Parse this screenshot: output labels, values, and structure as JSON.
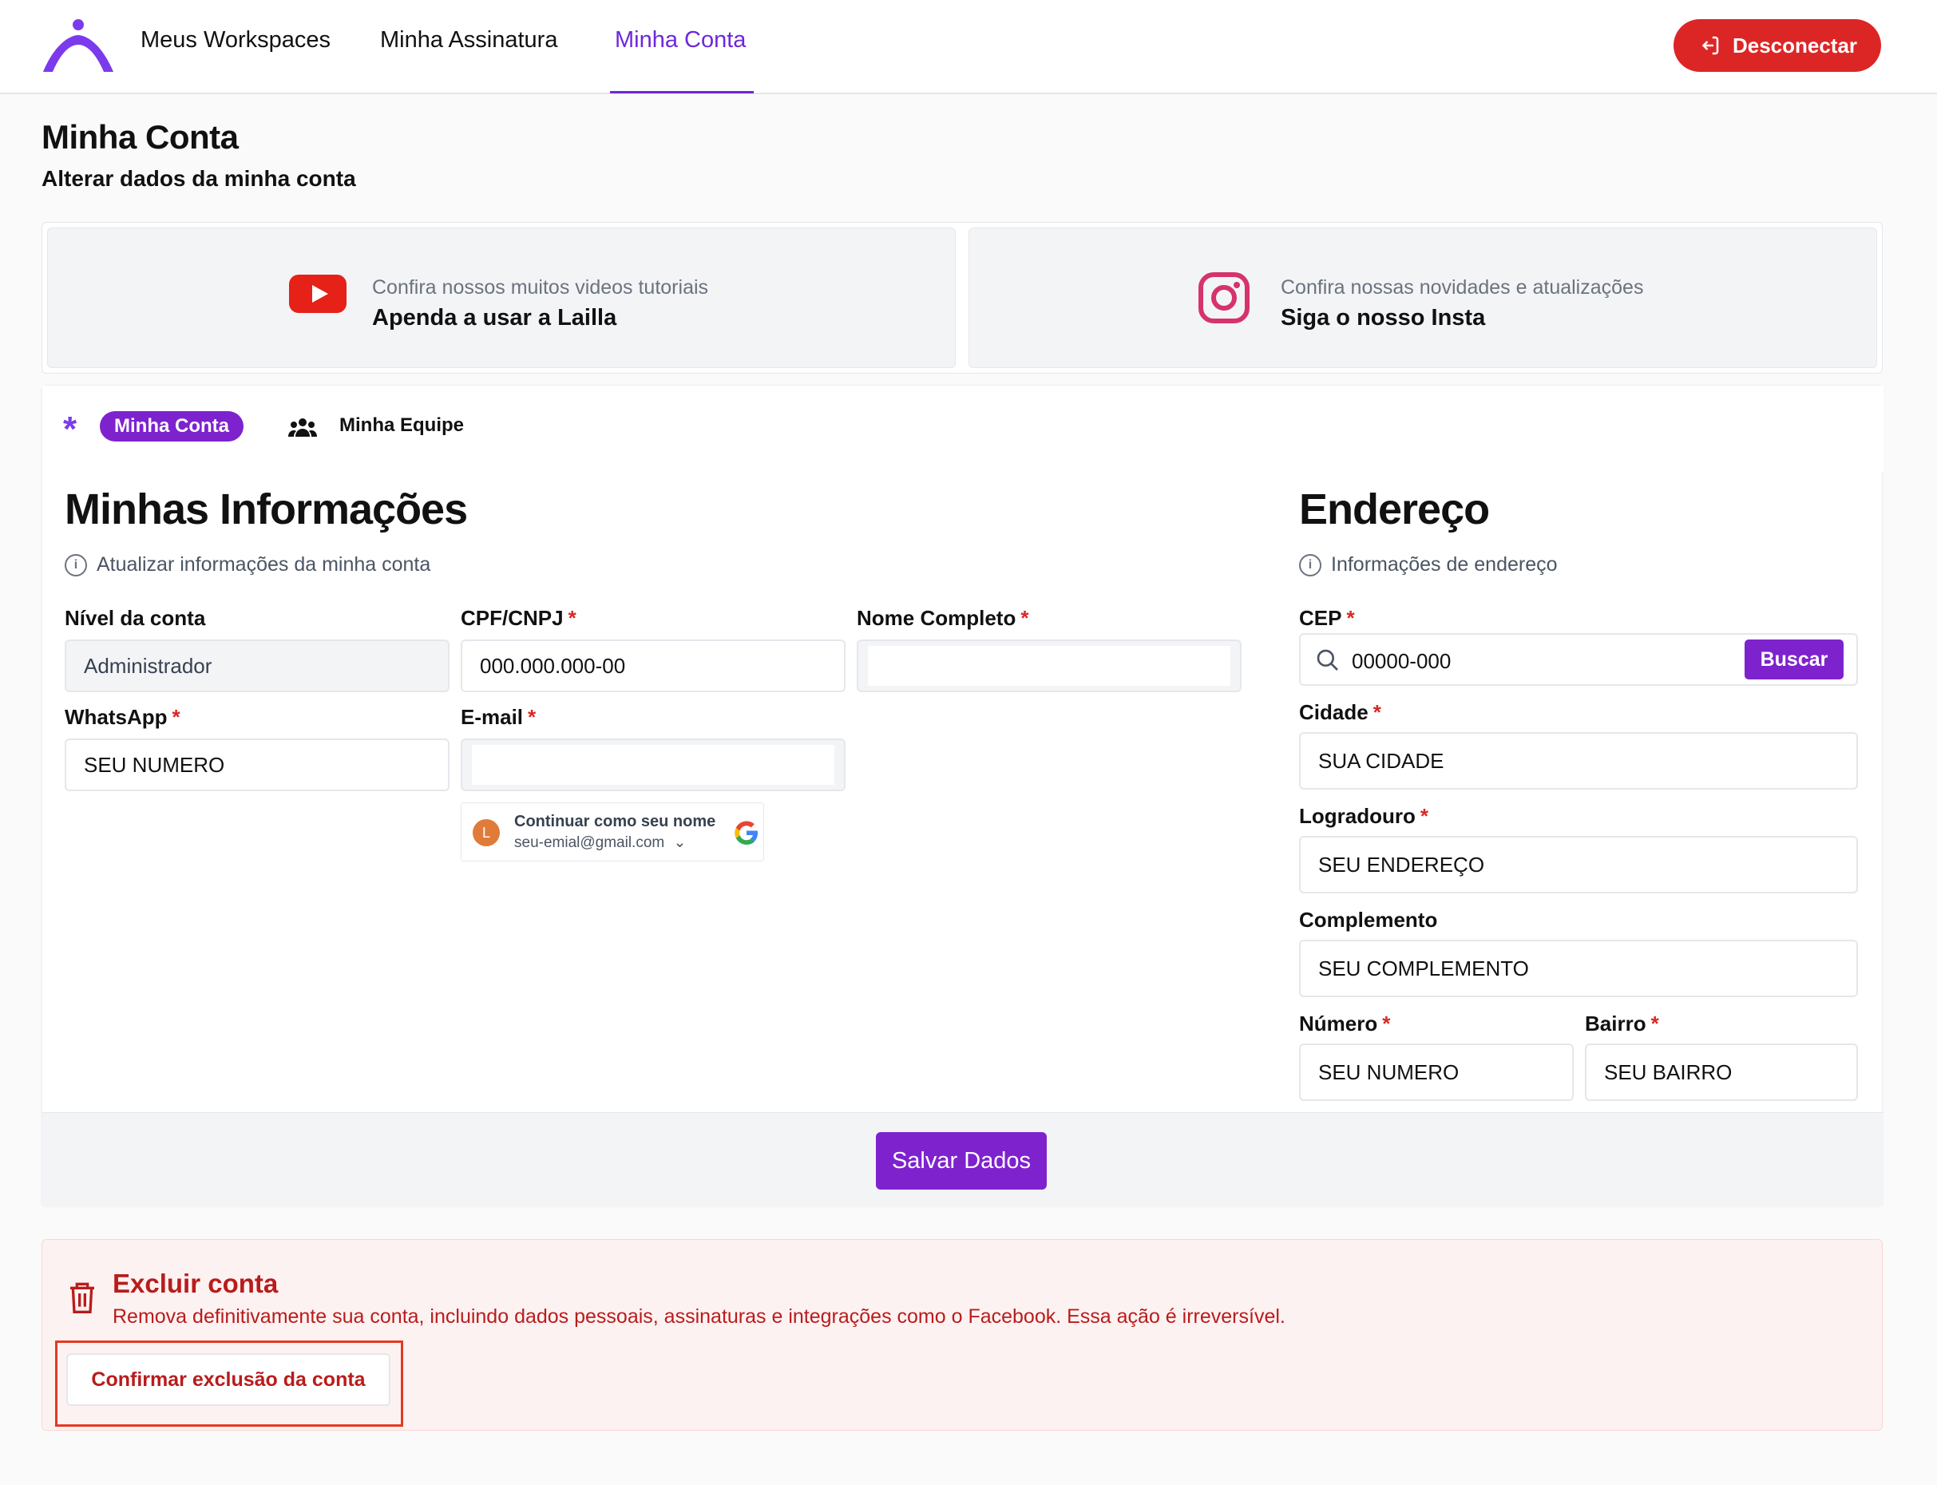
{
  "nav": {
    "items": [
      {
        "label": "Meus Workspaces"
      },
      {
        "label": "Minha Assinatura"
      },
      {
        "label": "Minha Conta"
      }
    ],
    "logout_label": "Desconectar"
  },
  "header": {
    "title": "Minha Conta",
    "subtitle": "Alterar dados da minha conta"
  },
  "promos": [
    {
      "subtitle": "Confira nossos muitos videos tutoriais",
      "title": "Apenda a usar a Lailla",
      "icon": "youtube-icon"
    },
    {
      "subtitle": "Confira nossas novidades e atualizações",
      "title": "Siga o nosso Insta",
      "icon": "instagram-icon"
    }
  ],
  "tabs": {
    "account": "Minha Conta",
    "team": "Minha Equipe"
  },
  "info": {
    "title": "Minhas Informações",
    "subtitle": "Atualizar informações da minha conta",
    "fields": {
      "level_label": "Nível da conta",
      "level_value": "Administrador",
      "cpf_label": "CPF/CNPJ",
      "cpf_value": "000.000.000-00",
      "name_label": "Nome Completo",
      "name_value": "",
      "whatsapp_label": "WhatsApp",
      "whatsapp_value": "SEU NUMERO",
      "email_label": "E-mail",
      "email_value": ""
    },
    "google_chip": {
      "avatar": "L",
      "name": "Continuar como seu nome",
      "email": "seu-emial@gmail.com"
    }
  },
  "address": {
    "title": "Endereço",
    "subtitle": "Informações de endereço",
    "cep_label": "CEP",
    "cep_value": "00000-000",
    "search_label": "Buscar",
    "city_label": "Cidade",
    "city_value": "SUA CIDADE",
    "street_label": "Logradouro",
    "street_value": "SEU ENDEREÇO",
    "complement_label": "Complemento",
    "complement_value": "SEU COMPLEMENTO",
    "number_label": "Número",
    "number_value": "SEU NUMERO",
    "district_label": "Bairro",
    "district_value": "SEU BAIRRO",
    "required_mark": "*"
  },
  "save_label": "Salvar Dados",
  "danger": {
    "title": "Excluir conta",
    "text": "Remova definitivamente sua conta, incluindo dados pessoais, assinaturas e integrações como o Facebook. Essa ação é irreversível.",
    "button": "Confirmar exclusão da conta"
  },
  "colors": {
    "accent": "#7e22ce",
    "danger": "#dc2626"
  }
}
